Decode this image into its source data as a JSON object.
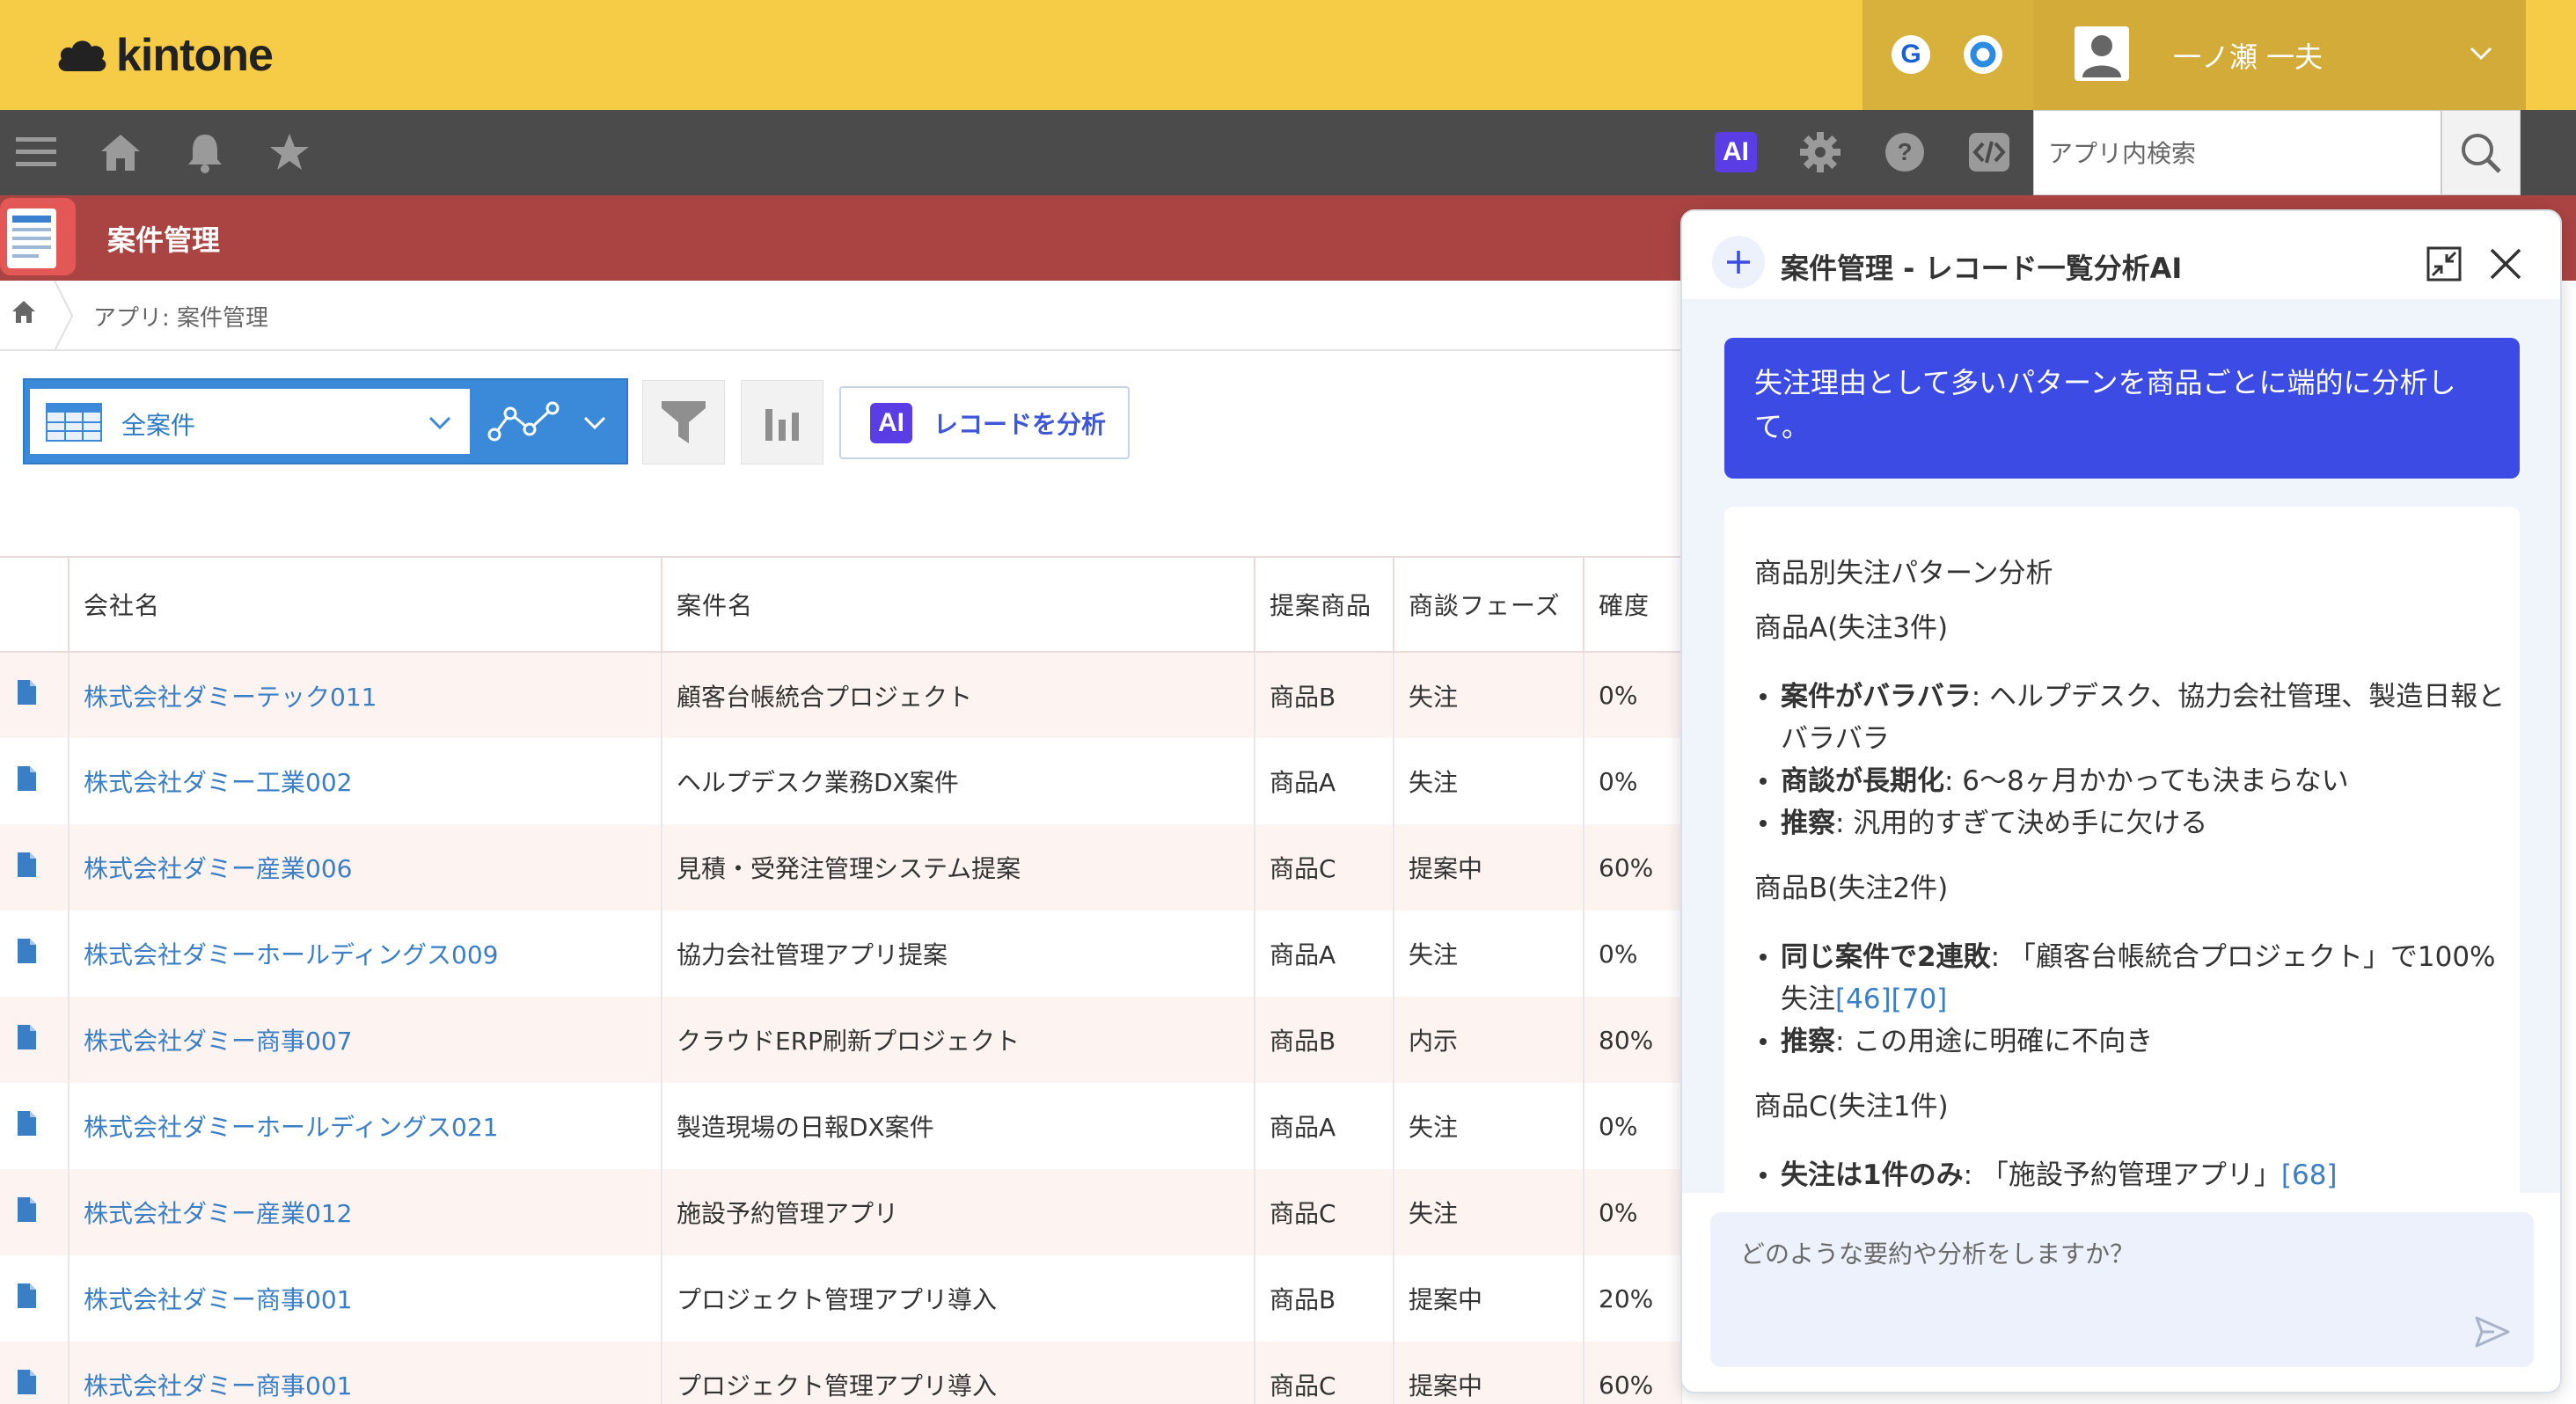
{
  "header": {
    "logo_text": "kintone",
    "badge_g": "G",
    "badge_o": "O",
    "user_name": "一ノ瀬 一夫"
  },
  "navbar": {
    "ai_badge": "AI",
    "search_placeholder": "アプリ内検索"
  },
  "app": {
    "title": "案件管理",
    "breadcrumb": "アプリ: 案件管理"
  },
  "toolbar": {
    "view_name": "全案件",
    "analyze_label": "レコードを分析",
    "ai_badge": "AI"
  },
  "table": {
    "headers": [
      "会社名",
      "案件名",
      "提案商品",
      "商談フェーズ",
      "確度"
    ],
    "rows": [
      {
        "company": "株式会社ダミーテック011",
        "deal": "顧客台帳統合プロジェクト",
        "product": "商品B",
        "phase": "失注",
        "prob": "0%"
      },
      {
        "company": "株式会社ダミー工業002",
        "deal": "ヘルプデスク業務DX案件",
        "product": "商品A",
        "phase": "失注",
        "prob": "0%"
      },
      {
        "company": "株式会社ダミー産業006",
        "deal": "見積・受発注管理システム提案",
        "product": "商品C",
        "phase": "提案中",
        "prob": "60%"
      },
      {
        "company": "株式会社ダミーホールディングス009",
        "deal": "協力会社管理アプリ提案",
        "product": "商品A",
        "phase": "失注",
        "prob": "0%"
      },
      {
        "company": "株式会社ダミー商事007",
        "deal": "クラウドERP刷新プロジェクト",
        "product": "商品B",
        "phase": "内示",
        "prob": "80%"
      },
      {
        "company": "株式会社ダミーホールディングス021",
        "deal": "製造現場の日報DX案件",
        "product": "商品A",
        "phase": "失注",
        "prob": "0%"
      },
      {
        "company": "株式会社ダミー産業012",
        "deal": "施設予約管理アプリ",
        "product": "商品C",
        "phase": "失注",
        "prob": "0%"
      },
      {
        "company": "株式会社ダミー商事001",
        "deal": "プロジェクト管理アプリ導入",
        "product": "商品B",
        "phase": "提案中",
        "prob": "20%"
      },
      {
        "company": "株式会社ダミー商事001",
        "deal": "プロジェクト管理アプリ導入",
        "product": "商品C",
        "phase": "提案中",
        "prob": "60%"
      }
    ]
  },
  "ai_panel": {
    "title": "案件管理 - レコード一覧分析AI",
    "user_message": "失注理由として多いパターンを商品ごとに端的に分析して。",
    "response": {
      "heading": "商品別失注パターン分析",
      "sections": [
        {
          "title": "商品A(失注3件)",
          "items": [
            {
              "bold": "案件がバラバラ",
              "text": ": ヘルプデスク、協力会社管理、製造日報とバラバラ"
            },
            {
              "bold": "商談が長期化",
              "text": ": 6〜8ヶ月かかっても決まらない"
            },
            {
              "bold": "推察",
              "text": ": 汎用的すぎて決め手に欠ける"
            }
          ]
        },
        {
          "title": "商品B(失注2件)",
          "items": [
            {
              "bold": "同じ案件で2連敗",
              "text": ": 「顧客台帳統合プロジェクト」で100%失注",
              "cite1": "[46]",
              "cite2": "[70]"
            },
            {
              "bold": "推察",
              "text": ": この用途に明確に不向き"
            }
          ]
        },
        {
          "title": "商品C(失注1件)",
          "items": [
            {
              "bold": "失注は1件のみ",
              "text": ": 「施設予約管理アプリ」",
              "cite1": "[68]"
            }
          ]
        }
      ]
    },
    "input_placeholder": "どのような要約や分析をしますか？"
  },
  "colors": {
    "topbar": "#f6cb45",
    "navbar": "#4b4b4b",
    "appbar": "#a94442",
    "link": "#3a7ec6",
    "ai_accent": "#3c4be3"
  }
}
